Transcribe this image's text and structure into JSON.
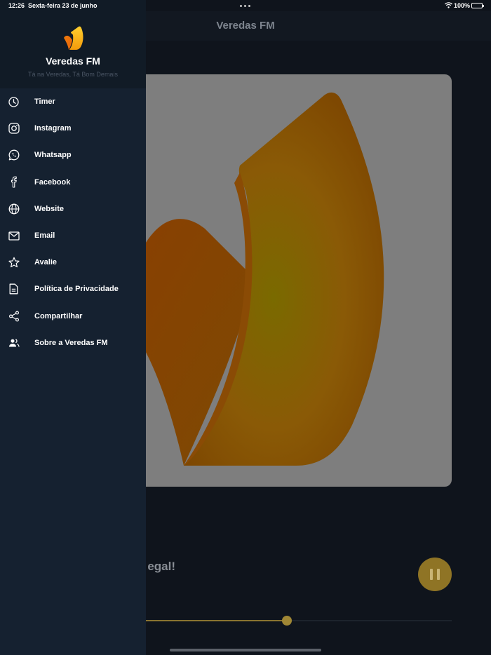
{
  "status_bar": {
    "time": "12:26",
    "date": "Sexta-feira 23 de junho",
    "battery": "100%"
  },
  "app": {
    "title": "Veredas FM"
  },
  "drawer": {
    "brand_name": "Veredas FM",
    "slogan": "Tá na Veredas, Tá Bom Demais",
    "items": [
      {
        "label": "Timer",
        "icon": "clock-icon"
      },
      {
        "label": "Instagram",
        "icon": "instagram-icon"
      },
      {
        "label": "Whatsapp",
        "icon": "whatsapp-icon"
      },
      {
        "label": "Facebook",
        "icon": "facebook-icon"
      },
      {
        "label": "Website",
        "icon": "globe-icon"
      },
      {
        "label": "Email",
        "icon": "mail-icon"
      },
      {
        "label": "Avalie",
        "icon": "star-icon"
      },
      {
        "label": "Política de Privacidade",
        "icon": "document-icon"
      },
      {
        "label": "Compartilhar",
        "icon": "share-icon"
      },
      {
        "label": "Sobre a Veredas FM",
        "icon": "people-icon"
      }
    ]
  },
  "player": {
    "song_title_visible": "egal!",
    "progress": 0.635
  },
  "colors": {
    "drawer_bg": "#152130",
    "drawer_header_bg": "#111b26",
    "accent": "#c9a53a",
    "background": "#0f141c"
  }
}
